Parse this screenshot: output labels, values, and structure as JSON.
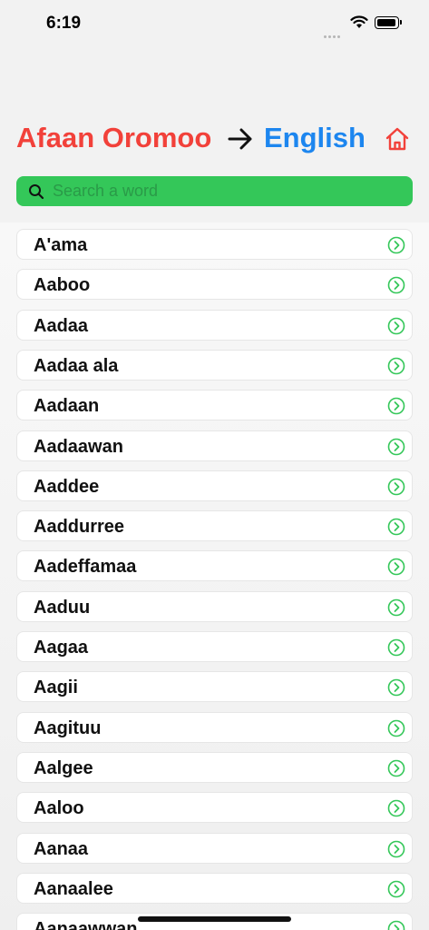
{
  "status_bar": {
    "time": "6:19"
  },
  "header": {
    "source_language": "Afaan Oromoo",
    "target_language": "English",
    "colors": {
      "source": "#f2413a",
      "target": "#1d86ef",
      "home": "#f2413a"
    }
  },
  "search": {
    "placeholder": "Search a word",
    "value": "",
    "color": "#34c759"
  },
  "words": [
    "A'ama",
    "Aaboo",
    "Aadaa",
    "Aadaa ala",
    "Aadaan",
    "Aadaawan",
    "Aaddee",
    "Aaddurree",
    "Aadeffamaa",
    "Aaduu",
    "Aagaa",
    "Aagii",
    "Aagituu",
    "Aalgee",
    "Aaloo",
    "Aanaa",
    "Aanaalee",
    "Aanaawwan"
  ],
  "icons": {
    "arrow": "arrow-right-icon",
    "home": "home-icon",
    "search": "search-icon",
    "row": "chevron-right-circle-icon"
  }
}
